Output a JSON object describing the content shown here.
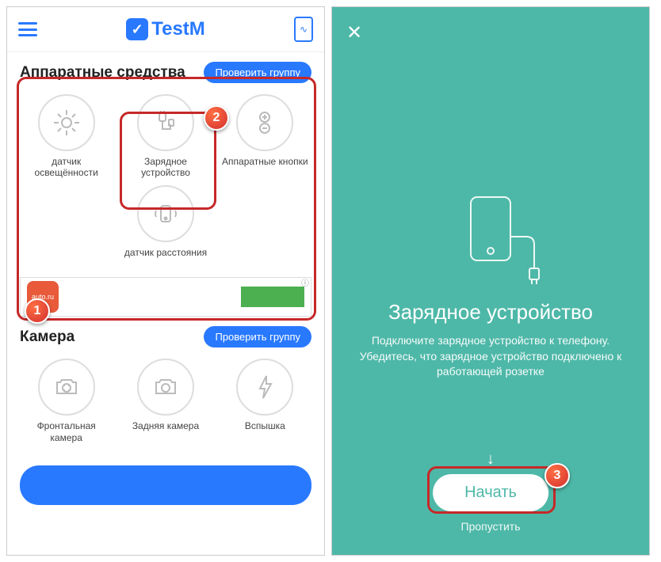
{
  "app_name": "TestM",
  "left": {
    "section1": {
      "title": "Аппаратные средства",
      "check_btn": "Проверить группу",
      "items": [
        {
          "label": "датчик освещённости"
        },
        {
          "label": "Зарядное устройство"
        },
        {
          "label": "Аппаратные кнопки"
        },
        {
          "label": "датчик расстояния"
        }
      ]
    },
    "section2": {
      "title": "Камера",
      "check_btn": "Проверить группу",
      "items": [
        {
          "label": "Фронтальная камера"
        },
        {
          "label": "Задняя камера"
        },
        {
          "label": "Вспышка"
        }
      ]
    },
    "ad_logo_text": "auto.ru"
  },
  "right": {
    "title": "Зарядное устройство",
    "desc": "Подключите зарядное устройство к телефону. Убедитесь, что зарядное устройство подключено к работающей розетке",
    "start_btn": "Начать",
    "skip": "Пропустить"
  },
  "callouts": {
    "c1": "1",
    "c2": "2",
    "c3": "3"
  }
}
